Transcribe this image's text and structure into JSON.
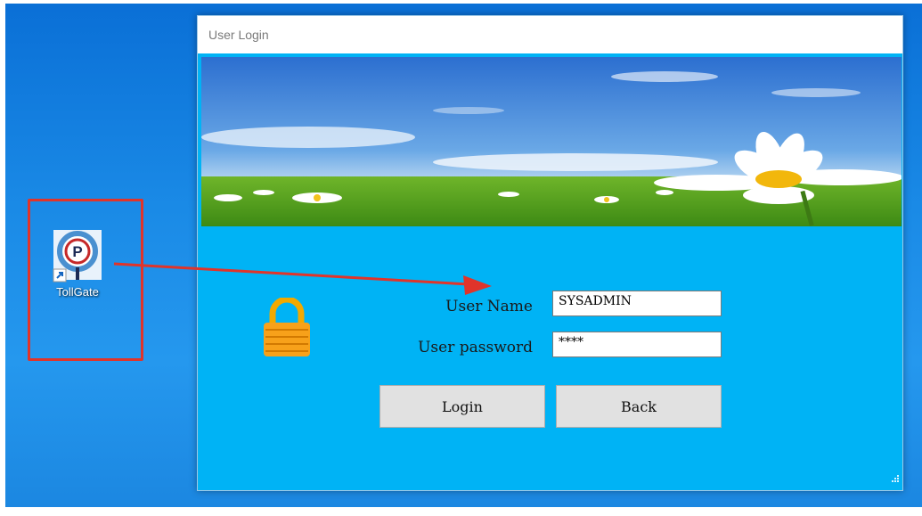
{
  "window": {
    "title": "User Login"
  },
  "desktop": {
    "shortcut_label": "TollGate",
    "shortcut_icon": "parking-p-icon",
    "icon_letter": "P"
  },
  "form": {
    "username_label": "User Name",
    "username_value": "SYSADMIN",
    "password_label": "User password",
    "password_value": "****",
    "login_label": "Login",
    "back_label": "Back"
  },
  "colors": {
    "window_bg": "#00b3f5",
    "annotation": "#e0342a",
    "button_bg": "#e1e1e1"
  }
}
